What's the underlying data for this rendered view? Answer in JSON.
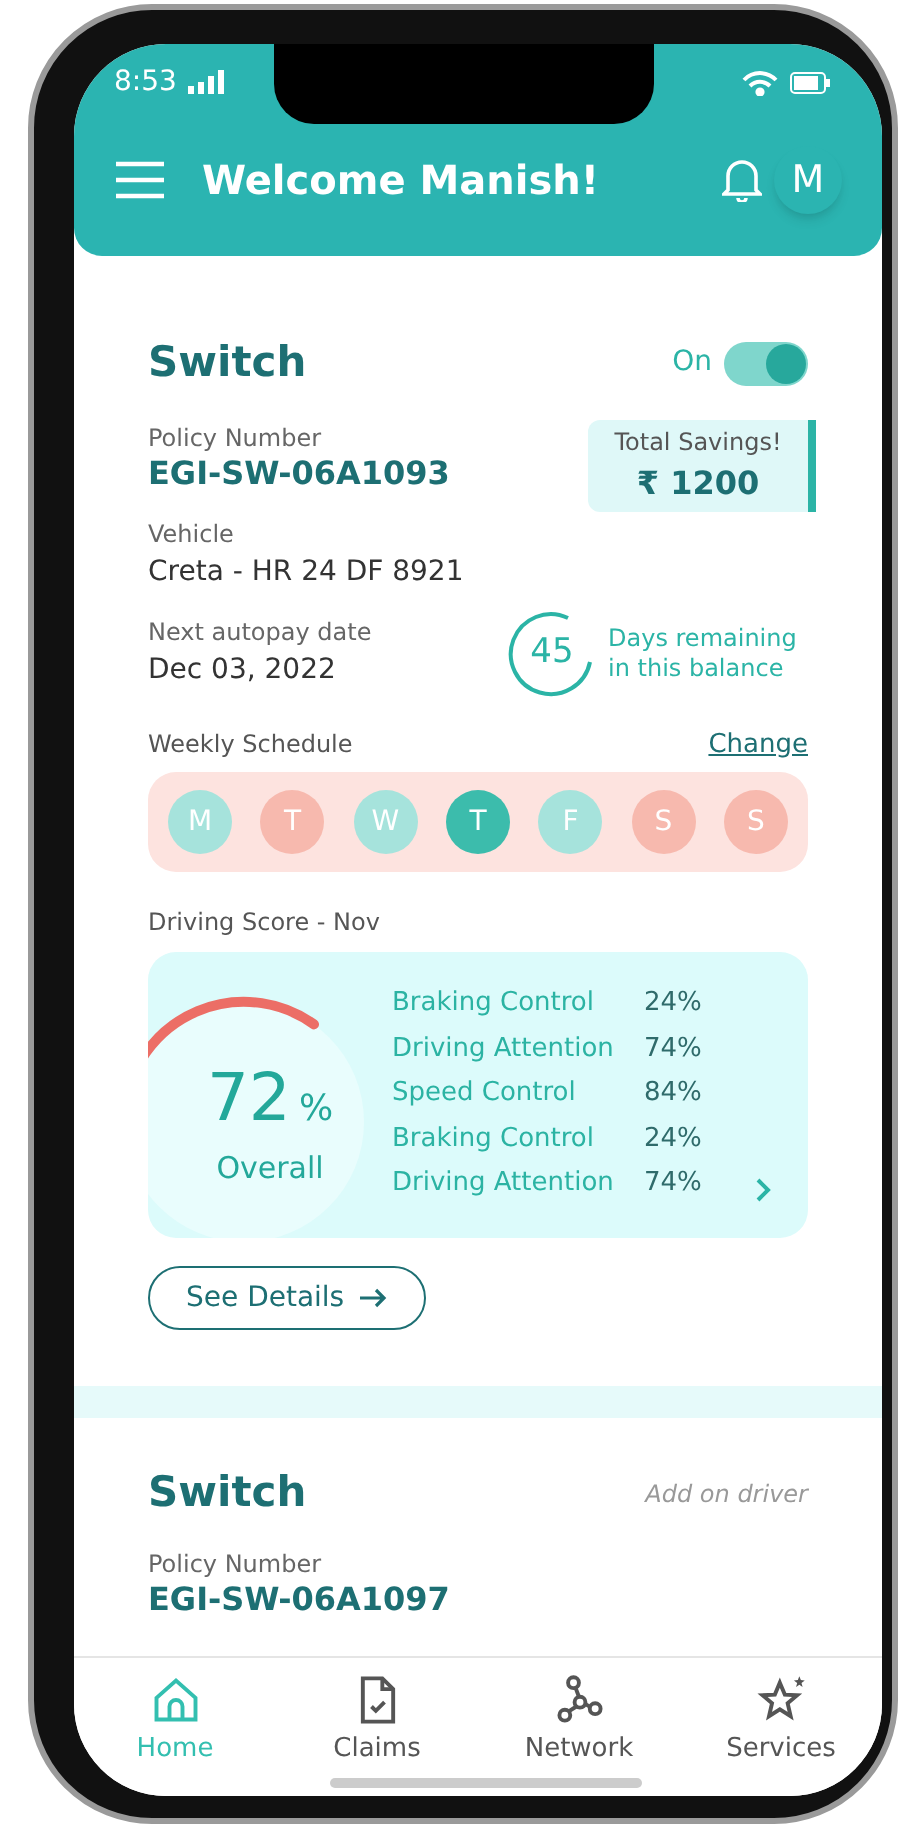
{
  "status_bar": {
    "time": "8:53"
  },
  "header": {
    "title": "Welcome Manish!",
    "avatar": "M"
  },
  "policies": [
    {
      "title": "Switch",
      "toggle": {
        "label": "On",
        "on": true
      },
      "policy_label": "Policy Number",
      "policy_number": "EGI-SW-06A1093",
      "savings": {
        "label": "Total Savings!",
        "amount": "₹ 1200"
      },
      "vehicle_label": "Vehicle",
      "vehicle": "Creta - HR 24 DF 8921",
      "autopay_label": "Next autopay date",
      "autopay_date": "Dec 03, 2022",
      "days": {
        "count": "45",
        "text": "Days remaining in this balance"
      },
      "schedule": {
        "label": "Weekly Schedule",
        "action": "Change",
        "days": [
          {
            "letter": "M",
            "color": "#a6e3dc"
          },
          {
            "letter": "T",
            "color": "#f7b9ae"
          },
          {
            "letter": "W",
            "color": "#a6e3dc"
          },
          {
            "letter": "T",
            "color": "#3cbcac"
          },
          {
            "letter": "F",
            "color": "#a6e3dc"
          },
          {
            "letter": "S",
            "color": "#f7b9ae"
          },
          {
            "letter": "S",
            "color": "#f7b9ae"
          }
        ]
      },
      "score": {
        "label": "Driving Score - Nov",
        "value": "72",
        "unit": "%",
        "caption": "Overall",
        "metrics": [
          {
            "name": "Braking Control",
            "value": "24%"
          },
          {
            "name": "Driving Attention",
            "value": "74%"
          },
          {
            "name": "Speed Control",
            "value": "84%"
          },
          {
            "name": "Braking Control",
            "value": "24%"
          },
          {
            "name": "Driving Attention",
            "value": "74%"
          }
        ]
      },
      "details_button": "See Details"
    }
  ],
  "second_policy": {
    "title": "Switch",
    "tag": "Add on driver",
    "policy_label": "Policy Number",
    "policy_number": "EGI-SW-06A1097"
  },
  "nav": [
    {
      "label": "Home",
      "selected": true
    },
    {
      "label": "Claims",
      "selected": false
    },
    {
      "label": "Network",
      "selected": false
    },
    {
      "label": "Services",
      "selected": false
    }
  ]
}
